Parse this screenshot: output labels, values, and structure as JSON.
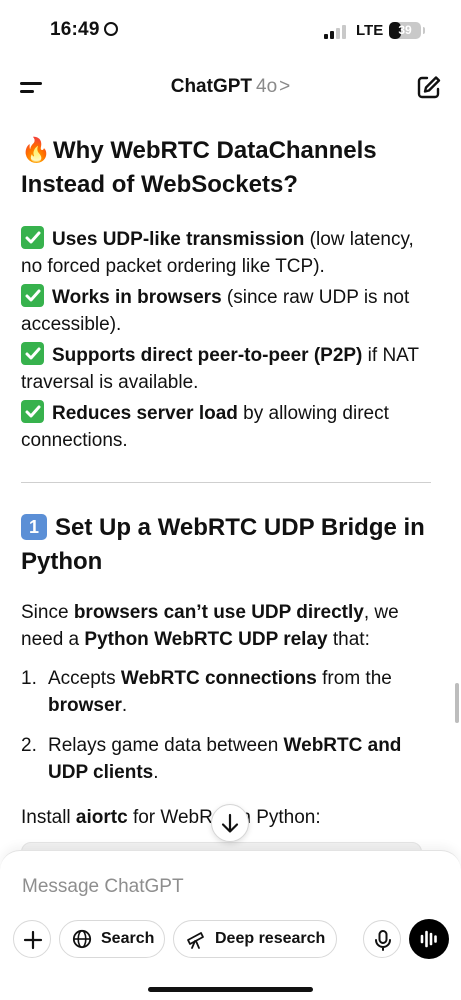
{
  "status_bar": {
    "time": "16:49",
    "network": "LTE",
    "battery": "39",
    "battery_level": 0.39
  },
  "header": {
    "app_name": "ChatGPT",
    "model": "4o",
    "chevron": ">"
  },
  "content": {
    "section1": {
      "heading_emoji": "🔥",
      "heading": "Why WebRTC DataChannels Instead of WebSockets?",
      "items": [
        {
          "bold": "Uses UDP-like transmission",
          "rest": " (low latency, no forced packet ordering like TCP)."
        },
        {
          "bold": "Works in browsers",
          "rest": " (since raw UDP is not accessible)."
        },
        {
          "bold": "Supports direct peer-to-peer (P2P)",
          "rest": " if NAT traversal is available."
        },
        {
          "bold": "Reduces server load",
          "rest": " by allowing direct connections."
        }
      ]
    },
    "section2": {
      "number": "1",
      "heading": "Set Up a WebRTC UDP Bridge in Python",
      "intro_1": "Since ",
      "intro_bold_1": "browsers can’t use UDP directly",
      "intro_2": ", we need a ",
      "intro_bold_2": "Python WebRTC UDP relay",
      "intro_3": " that:",
      "list": [
        {
          "num": "1.",
          "pre": "Accepts ",
          "bold": "WebRTC connections",
          "mid": " from the ",
          "bold2": "browser",
          "post": "."
        },
        {
          "num": "2.",
          "pre": "Relays game data between ",
          "bold": "WebRTC and UDP clients",
          "mid": "",
          "bold2": "",
          "post": "."
        }
      ],
      "install_pre": "Install ",
      "install_bold": "aiortc",
      "install_mid": " for WebR",
      "install_post": " in Python:"
    }
  },
  "composer": {
    "placeholder": "Message ChatGPT",
    "search_label": "Search",
    "deep_research_label": "Deep research"
  },
  "icons": {
    "plus": "plus-icon",
    "globe": "globe-icon",
    "telescope": "telescope-icon",
    "mic": "microphone-icon",
    "voice": "voice-mode-icon",
    "scroll_down": "arrow-down-icon",
    "compose": "new-chat-icon",
    "menu": "menu-icon"
  },
  "colors": {
    "check_green": "#37b24d",
    "number_blue": "#5b8fd6",
    "placeholder_gray": "#8e8e8e"
  }
}
